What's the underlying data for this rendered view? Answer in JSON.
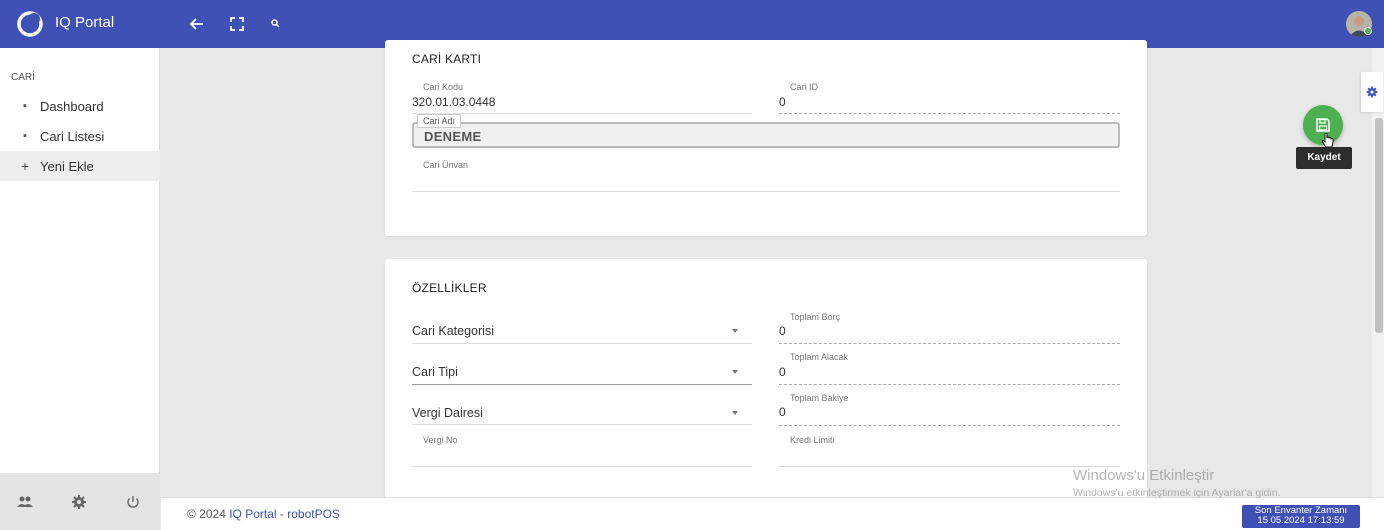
{
  "app": {
    "title": "IQ Portal"
  },
  "sidebar": {
    "section": "CARİ",
    "items": [
      {
        "label": "Dashboard",
        "icon": "grid-icon"
      },
      {
        "label": "Cari Listesi",
        "icon": "grid-icon"
      },
      {
        "label": "Yeni Ekle",
        "icon": "plus-icon",
        "active": true
      }
    ]
  },
  "cari_karti": {
    "title": "CARİ KARTI",
    "cari_kodu": {
      "label": "Cari Kodu",
      "value": "320.01.03.0448"
    },
    "cari_id": {
      "label": "Cari ID",
      "value": "0"
    },
    "cari_adi": {
      "label": "Cari Adı",
      "value": "DENEME"
    },
    "cari_unvan": {
      "label": "Cari Ünvan",
      "value": ""
    }
  },
  "ozellikler": {
    "title": "ÖZELLİKLER",
    "cari_kategorisi": "Cari Kategorisi",
    "cari_tipi": "Cari Tipi",
    "vergi_dairesi": "Vergi Dairesi",
    "vergi_no": {
      "label": "Vergi No",
      "value": ""
    },
    "toplam_borc": {
      "label": "Toplam Borç",
      "value": "0"
    },
    "toplam_alacak": {
      "label": "Toplam Alacak",
      "value": "0"
    },
    "toplam_bakiye": {
      "label": "Toplam Bakiye",
      "value": "0"
    },
    "kredi_limiti": {
      "label": "Kredi Limiti",
      "value": ""
    }
  },
  "save_tooltip": "Kaydet",
  "footer": {
    "copyright": "© 2024 ",
    "link": "IQ Portal - robotPOS",
    "inventory_label": "Son Envanter Zamanı",
    "inventory_time": "15.05.2024 17:13:59"
  },
  "watermark": {
    "title": "Windows'u Etkinleştir",
    "subtitle": "Windows'u etkinleştirmek için Ayarlar'a gidin."
  },
  "colors": {
    "primary": "#3f51b5",
    "fab": "#4caf50"
  }
}
